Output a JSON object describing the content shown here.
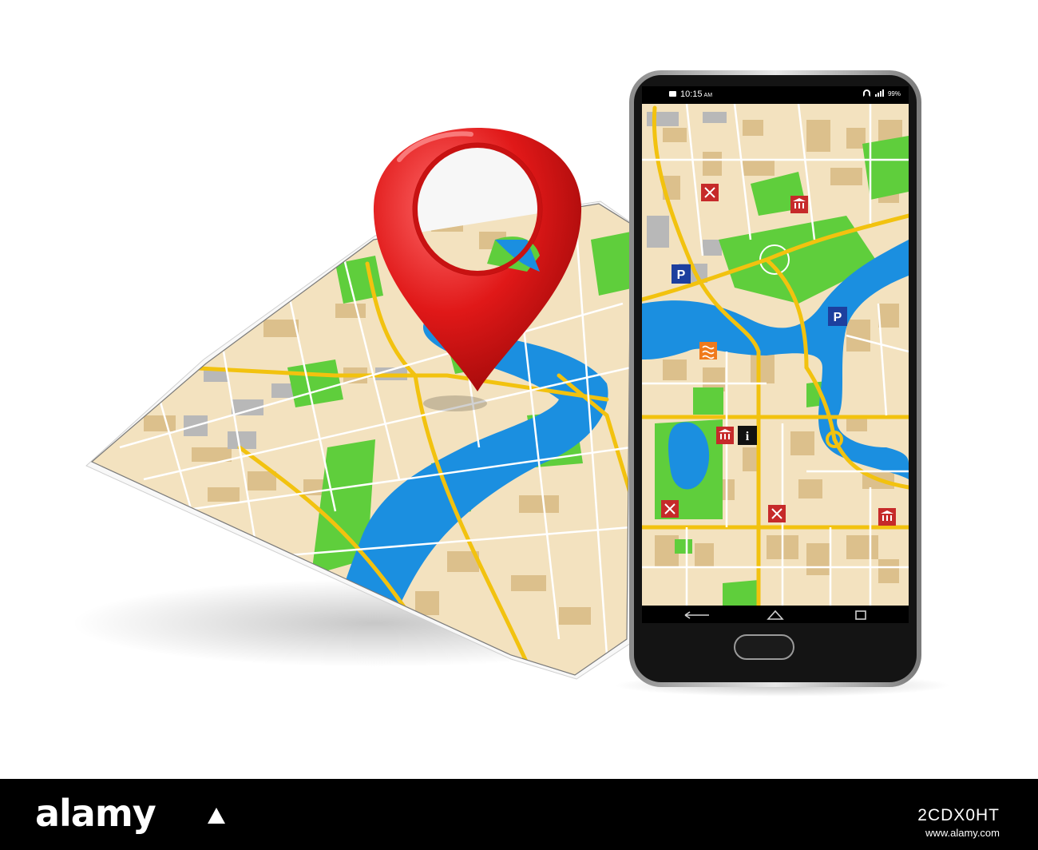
{
  "phone": {
    "status_time": "10:15",
    "status_ampm": "AM",
    "status_battery": "99%"
  },
  "map_icons": {
    "parking_label": "P",
    "info_label": "i"
  },
  "watermark": {
    "brand": "alamy",
    "image_id": "2CDX0HT",
    "url": "www.alamy.com"
  },
  "colors": {
    "pin_red": "#d71414",
    "water_blue": "#1b8fe0",
    "park_green": "#5fce3c",
    "road_yellow": "#f2c20f",
    "block_beige": "#f3e2bf",
    "building_tan": "#dcc08c",
    "footer_black": "#000000"
  },
  "icons": [
    "map-pin-icon",
    "parking-icon",
    "restaurant-icon",
    "museum-icon",
    "info-icon",
    "pool-icon",
    "back-nav-icon",
    "home-nav-icon",
    "recent-apps-icon"
  ]
}
